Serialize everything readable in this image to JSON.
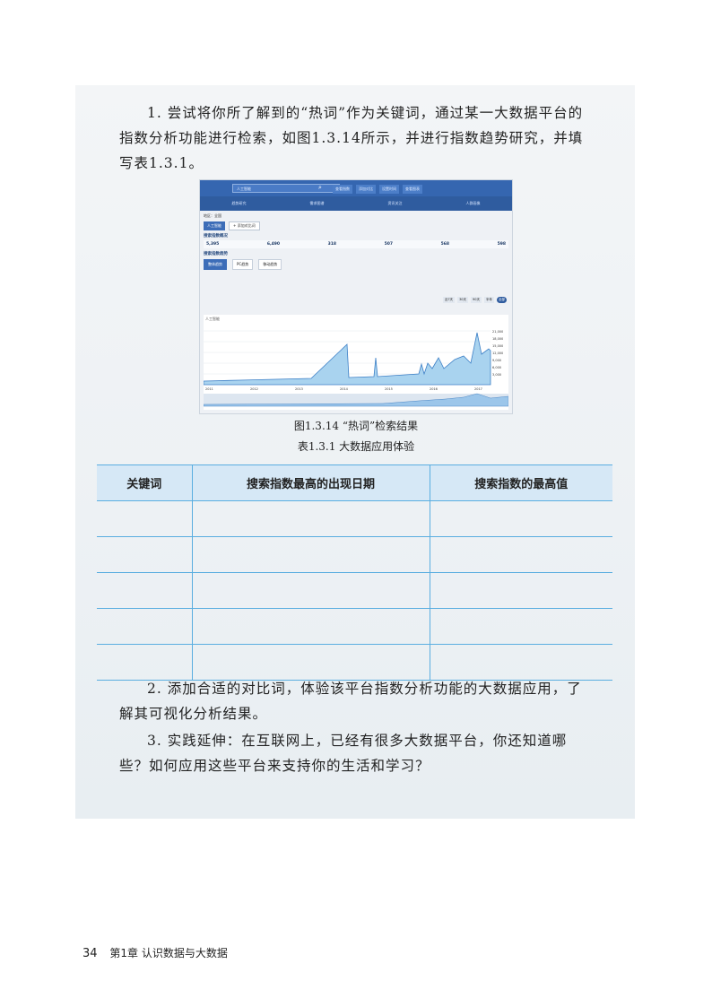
{
  "paragraphs": {
    "p1": "1. 尝试将你所了解到的“热词”作为关键词，通过某一大数据平台的指数分析功能进行检索，如图1.3.14所示，并进行指数趋势研究，并填写表1.3.1。",
    "p2": "2. 添加合适的对比词，体验该平台指数分析功能的大数据应用，了解其可视化分析结果。",
    "p3": "3. 实践延伸：在互联网上，已经有很多大数据平台，你还知道哪些？如何应用这些平台来支持你的生活和学习？"
  },
  "screenshot": {
    "search_value": "人工智能",
    "top_buttons": [
      "查看指数",
      "添加对比",
      "设置时间",
      "查看图表"
    ],
    "nav": [
      "趋势研究",
      "需求图谱",
      "资讯关注",
      "人群画像"
    ],
    "region": "地区：全国",
    "selected_term": "人工智能",
    "add_compare": "+ 添加对比词",
    "overview_title": "搜索指数概况",
    "stats": [
      "5,395",
      "6,490",
      "318",
      "507",
      "568",
      "598"
    ],
    "trend_title": "搜索指数趋势",
    "tabs": [
      "整体趋势",
      "PC趋势",
      "移动趋势"
    ],
    "ranges": [
      "近7天",
      "30天",
      "90天",
      "半年",
      "全部"
    ],
    "legend": "人工智能",
    "y_ticks": [
      "21,000",
      "18,000",
      "15,000",
      "12,000",
      "9,000",
      "6,000",
      "3,000"
    ],
    "years": [
      "2011",
      "2012",
      "2013",
      "2014",
      "2015",
      "2016",
      "2017"
    ]
  },
  "figure_caption": "图1.3.14 “热词”检索结果",
  "table_caption": "表1.3.1 大数据应用体验",
  "table": {
    "headers": [
      "关键词",
      "搜索指数最高的出现日期",
      "搜索指数的最高值"
    ],
    "rows": 5
  },
  "footer": {
    "page_number": "34",
    "chapter": "第1章 认识数据与大数据"
  },
  "colors": {
    "header_blue": "#3566b0",
    "table_border": "#5aaee0",
    "table_header_bg": "#d6e8f6"
  }
}
